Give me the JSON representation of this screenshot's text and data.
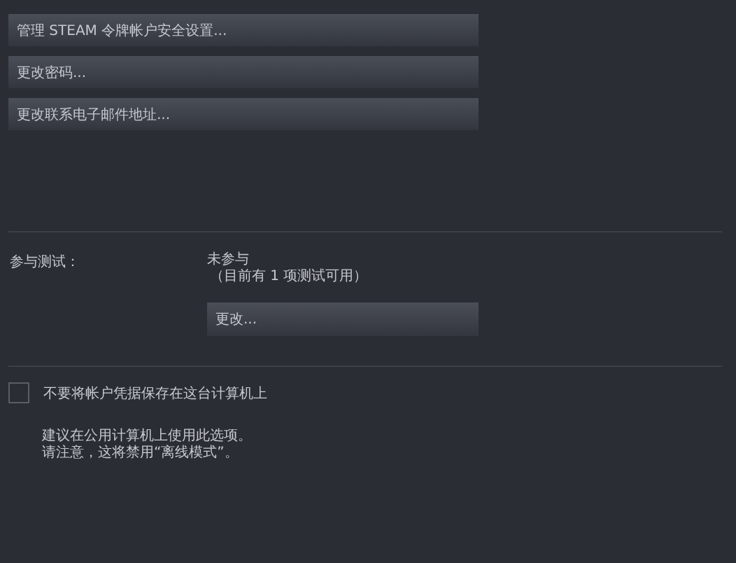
{
  "buttons": [
    {
      "label": "管理 STEAM 令牌帐户安全设置..."
    },
    {
      "label": "更改密码..."
    },
    {
      "label": "更改联系电子邮件地址..."
    }
  ],
  "beta": {
    "label": "参与测试：",
    "status": "未参与",
    "note": "（目前有 1 项测试可用）",
    "button": "更改..."
  },
  "remember": {
    "label": "不要将帐户凭据保存在这台计算机上",
    "checked": false,
    "hint": [
      "建议在公用计算机上使用此选项。",
      "请注意，这将禁用“离线模式”。"
    ]
  }
}
